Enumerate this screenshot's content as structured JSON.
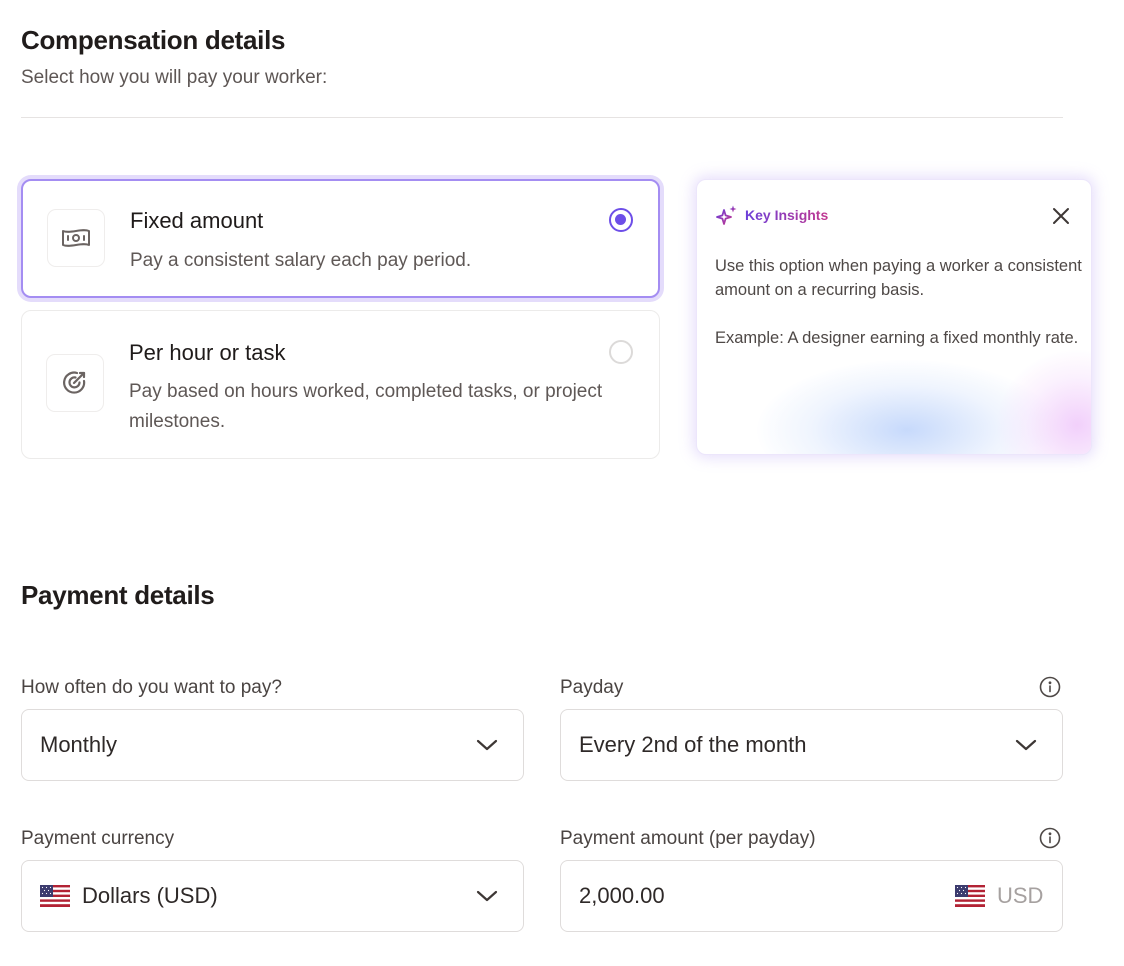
{
  "compensation": {
    "title": "Compensation details",
    "subtitle": "Select how you will pay your worker:",
    "options": [
      {
        "title": "Fixed amount",
        "description": "Pay a consistent salary each pay period.",
        "selected": true,
        "icon": "money-bill-icon"
      },
      {
        "title": "Per hour or task",
        "description": "Pay based on hours worked, completed tasks, or project milestones.",
        "selected": false,
        "icon": "target-arrow-icon"
      }
    ]
  },
  "insights": {
    "title": "Key Insights",
    "icon": "sparkles-icon",
    "body1": "Use this option when paying a worker a consistent amount on a recurring basis.",
    "body2": "Example: A designer earning a fixed monthly rate."
  },
  "payment": {
    "title": "Payment details",
    "frequency": {
      "label": "How often do you want to pay?",
      "value": "Monthly"
    },
    "payday": {
      "label": "Payday",
      "value": "Every 2nd of the month"
    },
    "currency": {
      "label": "Payment currency",
      "value": "Dollars (USD)",
      "flag": "us-flag-icon"
    },
    "amount": {
      "label": "Payment amount (per payday)",
      "value": "2,000.00",
      "suffix": "USD"
    }
  },
  "colors": {
    "accent": "#6d4ee8",
    "accent_soft": "#e4dcfb",
    "text": "#201c1b"
  }
}
